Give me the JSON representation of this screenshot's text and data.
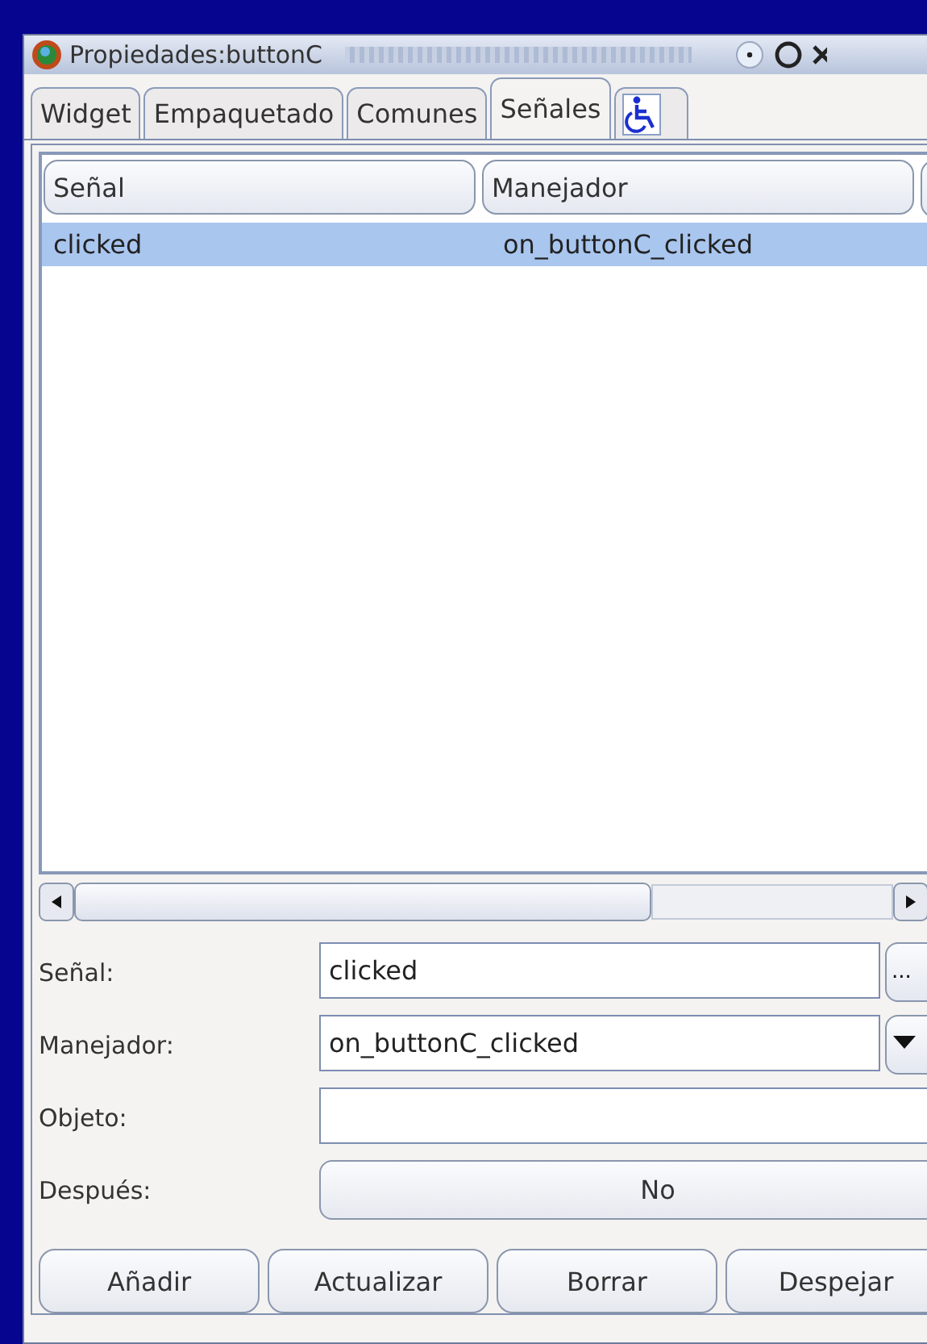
{
  "window": {
    "title": "Propiedades:buttonC"
  },
  "tabs": [
    {
      "label": "Widget",
      "selected": false,
      "kind": "text"
    },
    {
      "label": "Empaquetado",
      "selected": false,
      "kind": "text"
    },
    {
      "label": "Comunes",
      "selected": false,
      "kind": "text"
    },
    {
      "label": "Señales",
      "selected": true,
      "kind": "text"
    },
    {
      "selected": false,
      "kind": "accessibility"
    }
  ],
  "table": {
    "columns": [
      "Señal",
      "Manejador"
    ],
    "rows": [
      {
        "cells": [
          "clicked",
          "on_buttonC_clicked"
        ],
        "selected": true
      }
    ]
  },
  "form": [
    {
      "label": "Señal:",
      "kind": "entry",
      "value": "clicked",
      "button": "..."
    },
    {
      "label": "Manejador:",
      "kind": "combo",
      "value": "on_buttonC_clicked"
    },
    {
      "label": "Objeto:",
      "kind": "entry"
    },
    {
      "label": "Después:",
      "kind": "toggle",
      "value": "No"
    }
  ],
  "buttons": [
    "Añadir",
    "Actualizar",
    "Borrar",
    "Despejar"
  ]
}
